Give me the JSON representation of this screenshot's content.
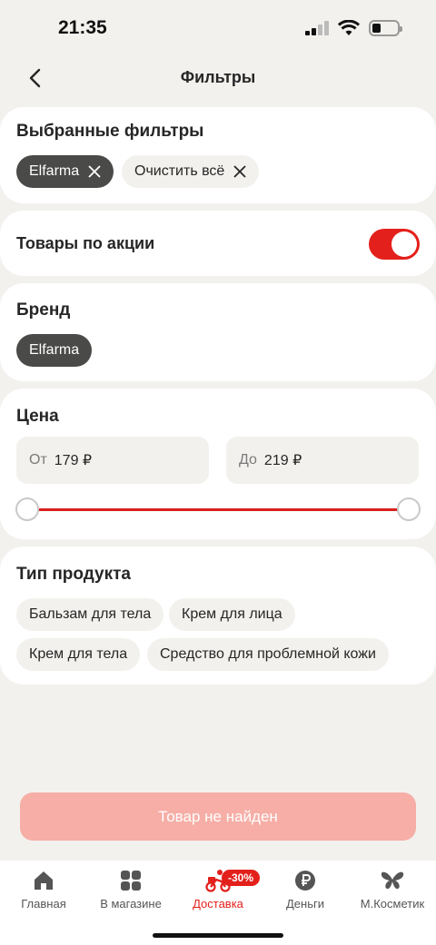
{
  "status": {
    "time": "21:35"
  },
  "header": {
    "title": "Фильтры"
  },
  "selected": {
    "title": "Выбранные фильтры",
    "chip": "Elfarma",
    "clear_all": "Очистить всё"
  },
  "promo": {
    "label": "Товары по акции",
    "enabled": true
  },
  "brand": {
    "title": "Бренд",
    "chip": "Elfarma"
  },
  "price": {
    "title": "Цена",
    "from_prefix": "От",
    "from_value": "179 ₽",
    "to_prefix": "До",
    "to_value": "219 ₽",
    "range": [
      179,
      219
    ]
  },
  "product_type": {
    "title": "Тип продукта",
    "chips": [
      "Бальзам для тела",
      "Крем для лица",
      "Крем для тела",
      "Средство для проблемной кожи"
    ]
  },
  "cta": {
    "label": "Товар не найден"
  },
  "tabbar": {
    "items": [
      {
        "label": "Главная",
        "icon": "home-icon"
      },
      {
        "label": "В магазине",
        "icon": "grid-icon"
      },
      {
        "label": "Доставка",
        "icon": "courier-icon",
        "badge": "-30%"
      },
      {
        "label": "Деньги",
        "icon": "ruble-icon"
      },
      {
        "label": "М.Косметик",
        "icon": "butterfly-icon"
      }
    ]
  },
  "colors": {
    "accent": "#e3201b",
    "chip_dark": "#4a4a48",
    "background": "#f2f1ee",
    "cta_disabled": "#f6aea6"
  }
}
